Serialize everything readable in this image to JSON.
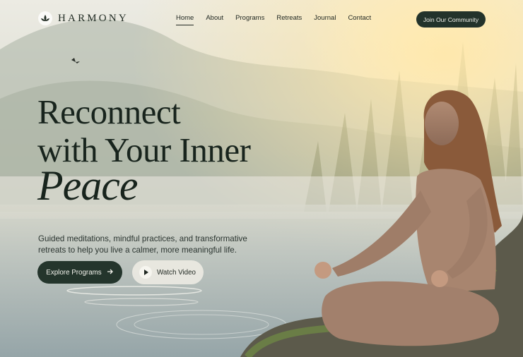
{
  "brand": {
    "name": "HARMONY",
    "logo_icon": "lotus-icon"
  },
  "nav": {
    "items": [
      {
        "label": "Home",
        "active": true
      },
      {
        "label": "About"
      },
      {
        "label": "Programs"
      },
      {
        "label": "Retreats"
      },
      {
        "label": "Journal"
      },
      {
        "label": "Contact"
      }
    ],
    "cta_label": "Join Our Community"
  },
  "hero": {
    "title_line1": "Reconnect",
    "title_line2": "with Your Inner",
    "title_line3": "Peace",
    "subtitle": "Guided meditations, mindful practices, and transformative retreats to help you live a calmer, more meaningful life.",
    "primary_button": {
      "label": "Explore Programs",
      "icon": "arrow-right-icon"
    },
    "secondary_button": {
      "label": "Watch Video",
      "icon": "play-icon"
    }
  },
  "colors": {
    "brand_dark": "#23332b",
    "text_dark": "#18241d",
    "sunlight": "#f6d58a"
  }
}
